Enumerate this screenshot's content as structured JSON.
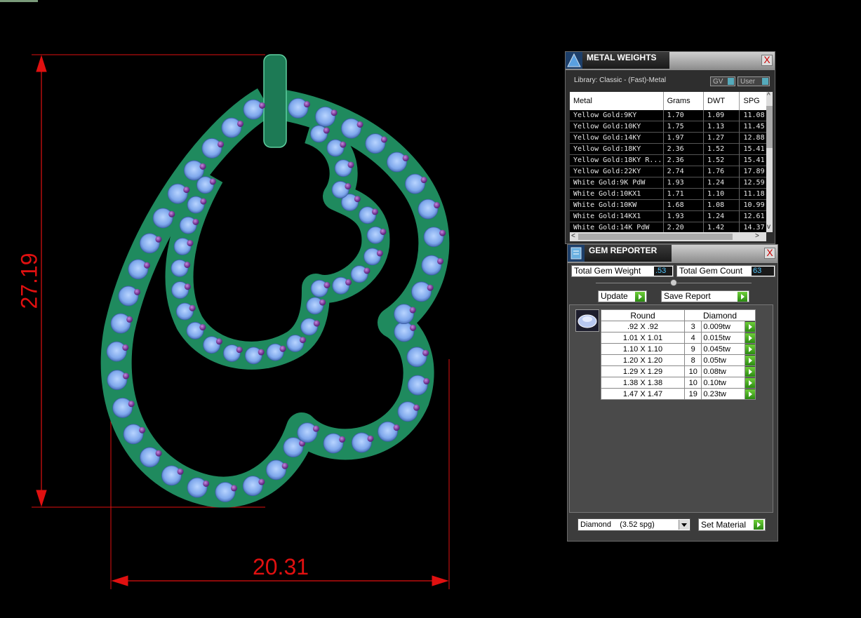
{
  "dimensions": {
    "height_label": "27.19",
    "width_label": "20.31"
  },
  "metal_weights": {
    "title": "METAL WEIGHTS",
    "close_label": "X",
    "library_label": "Library: Classic - (Fast)-Metal",
    "gv_label": "GV",
    "user_label": "User",
    "columns": [
      "Metal",
      "Grams",
      "DWT",
      "SPG"
    ],
    "rows": [
      [
        "Yellow Gold:9KY",
        "1.70",
        "1.09",
        "11.08"
      ],
      [
        "Yellow Gold:10KY",
        "1.75",
        "1.13",
        "11.45"
      ],
      [
        "Yellow Gold:14KY",
        "1.97",
        "1.27",
        "12.88"
      ],
      [
        "Yellow Gold:18KY",
        "2.36",
        "1.52",
        "15.41"
      ],
      [
        "Yellow Gold:18KY R...",
        "2.36",
        "1.52",
        "15.41"
      ],
      [
        "Yellow Gold:22KY",
        "2.74",
        "1.76",
        "17.89"
      ],
      [
        "White Gold:9K PdW",
        "1.93",
        "1.24",
        "12.59"
      ],
      [
        "White Gold:10KX1",
        "1.71",
        "1.10",
        "11.18"
      ],
      [
        "White Gold:10KW",
        "1.68",
        "1.08",
        "10.99"
      ],
      [
        "White Gold:14KX1",
        "1.93",
        "1.24",
        "12.61"
      ],
      [
        "White Gold:14K PdW",
        "2.20",
        "1.42",
        "14.37"
      ]
    ]
  },
  "gem_reporter": {
    "title": "GEM REPORTER",
    "close_label": "X",
    "total_weight_label": "Total Gem Weight",
    "total_weight_value": ".53",
    "total_count_label": "Total Gem Count",
    "total_count_value": "63",
    "update_label": "Update",
    "save_report_label": "Save Report",
    "shape_header": "Round",
    "material_header": "Diamond",
    "gems": [
      {
        "size": ".92 X .92",
        "count": "3",
        "weight": "0.009tw"
      },
      {
        "size": "1.01 X 1.01",
        "count": "4",
        "weight": "0.015tw"
      },
      {
        "size": "1.10 X 1.10",
        "count": "9",
        "weight": "0.045tw"
      },
      {
        "size": "1.20 X 1.20",
        "count": "8",
        "weight": "0.05tw"
      },
      {
        "size": "1.29 X 1.29",
        "count": "10",
        "weight": "0.08tw"
      },
      {
        "size": "1.38 X 1.38",
        "count": "10",
        "weight": "0.10tw"
      },
      {
        "size": "1.47 X 1.47",
        "count": "19",
        "weight": "0.23tw"
      }
    ],
    "material_select": "Diamond    (3.52 spg)",
    "set_material_label": "Set Material"
  },
  "colors": {
    "dimension": "#e01010",
    "metal": "#1f8a5e",
    "stone": "#7fb2ee",
    "prong": "#8a3ab0"
  }
}
